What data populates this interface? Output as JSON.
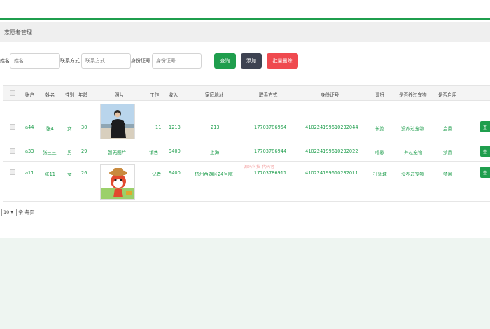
{
  "page_title": "志愿者管理",
  "search": {
    "name_label": "姓名",
    "name_placeholder": "姓名",
    "contact_label": "联系方式",
    "contact_placeholder": "联系方式",
    "id_label": "身份证号",
    "id_placeholder": "身份证号",
    "query_btn": "查询",
    "add_btn": "添加",
    "batch_delete_btn": "批量删除"
  },
  "colors": {
    "accent": "#1f9e4d",
    "dark": "#3e4352",
    "danger": "#ef4a4f"
  },
  "table": {
    "headers": [
      "账户",
      "姓名",
      "性别",
      "年龄",
      "照片",
      "工作",
      "收入",
      "家庭地址",
      "联系方式",
      "身份证号",
      "爱好",
      "是否养过宠物",
      "是否启用"
    ],
    "rows": [
      {
        "account": "a44",
        "name": "张4",
        "gender": "女",
        "age": "30",
        "photo": "photo-person",
        "photo_text": "",
        "job": "11",
        "income": "1213",
        "address": "213",
        "phone": "17703786954",
        "id_number": "410224199610232044",
        "hobby": "长跑",
        "pet": "没养过宠物",
        "enabled": "启用",
        "op": "查"
      },
      {
        "account": "a33",
        "name": "张三三",
        "gender": "男",
        "age": "29",
        "photo": "none",
        "photo_text": "暂无图片",
        "job": "销售",
        "income": "9400",
        "address": "上海",
        "phone": "17703786944",
        "id_number": "410224199610232022",
        "hobby": "唱歌",
        "pet": "养过宠物",
        "enabled": "禁用",
        "op": "查"
      },
      {
        "account": "a11",
        "name": "张11",
        "gender": "女",
        "age": "26",
        "photo": "photo-cartoon",
        "photo_text": "",
        "job": "记者",
        "income": "9400",
        "address": "杭州西湖区24号院",
        "phone": "17703786911",
        "id_number": "410224199610232011",
        "hobby": "打篮球",
        "pet": "没养过宠物",
        "enabled": "禁用",
        "op": "查"
      }
    ]
  },
  "pager": {
    "page_size": "10",
    "suffix": "条 每页"
  },
  "watermark": "源码科技-代码者"
}
